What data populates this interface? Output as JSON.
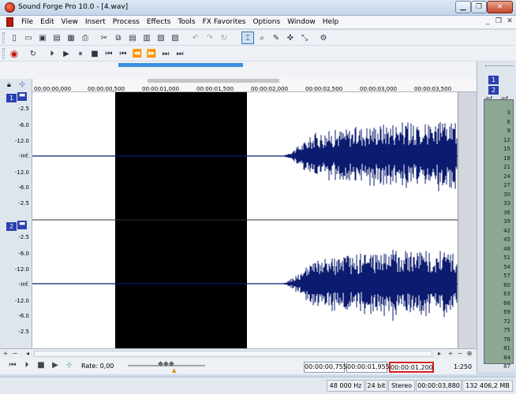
{
  "window": {
    "title": "Sound Forge Pro 10.0 - [4.wav]"
  },
  "menu": [
    "File",
    "Edit",
    "View",
    "Insert",
    "Process",
    "Effects",
    "Tools",
    "FX Favorites",
    "Options",
    "Window",
    "Help"
  ],
  "ruler": {
    "ticks": [
      "00:00:00,000",
      "00:00:00,500",
      "00:00:01,000",
      "00:00:01,500",
      "00:00:02,000",
      "00:00:02,500",
      "00:00:03,000",
      "00:00:03,500"
    ]
  },
  "channels": [
    {
      "number": "1",
      "db_labels": [
        "-2.5",
        "-6.0",
        "-12.0",
        "-Inf.",
        "-12.0",
        "-6.0",
        "-2.5"
      ]
    },
    {
      "number": "2",
      "db_labels": [
        "-2.5",
        "-6.0",
        "-12.0",
        "-Inf.",
        "-12.0",
        "-6.0",
        "-2.5"
      ]
    }
  ],
  "meters": {
    "channel_labels": [
      "1",
      "2"
    ],
    "top_labels": [
      "-Inf.",
      "-Inf."
    ],
    "scale": [
      "3",
      "6",
      "9",
      "12",
      "15",
      "18",
      "21",
      "24",
      "27",
      "30",
      "33",
      "36",
      "39",
      "42",
      "45",
      "48",
      "51",
      "54",
      "57",
      "60",
      "63",
      "66",
      "69",
      "72",
      "75",
      "78",
      "81",
      "84",
      "87"
    ]
  },
  "transport": {
    "rate_label": "Rate: 0,00",
    "selection_start": "00:00:00,755",
    "selection_end": "00:00:01,955",
    "selection_length": "00:00:01,200",
    "zoom_ratio": "1:250"
  },
  "status": {
    "sample_rate": "48 000 Hz",
    "bit_depth": "24 bit",
    "channels": "Stereo",
    "duration": "00:00:03,880",
    "free_space": "132 406,2 MB"
  },
  "colors": {
    "waveform": "#0b1b6f",
    "selection": "#000000",
    "highlight_box": "#d42020"
  }
}
